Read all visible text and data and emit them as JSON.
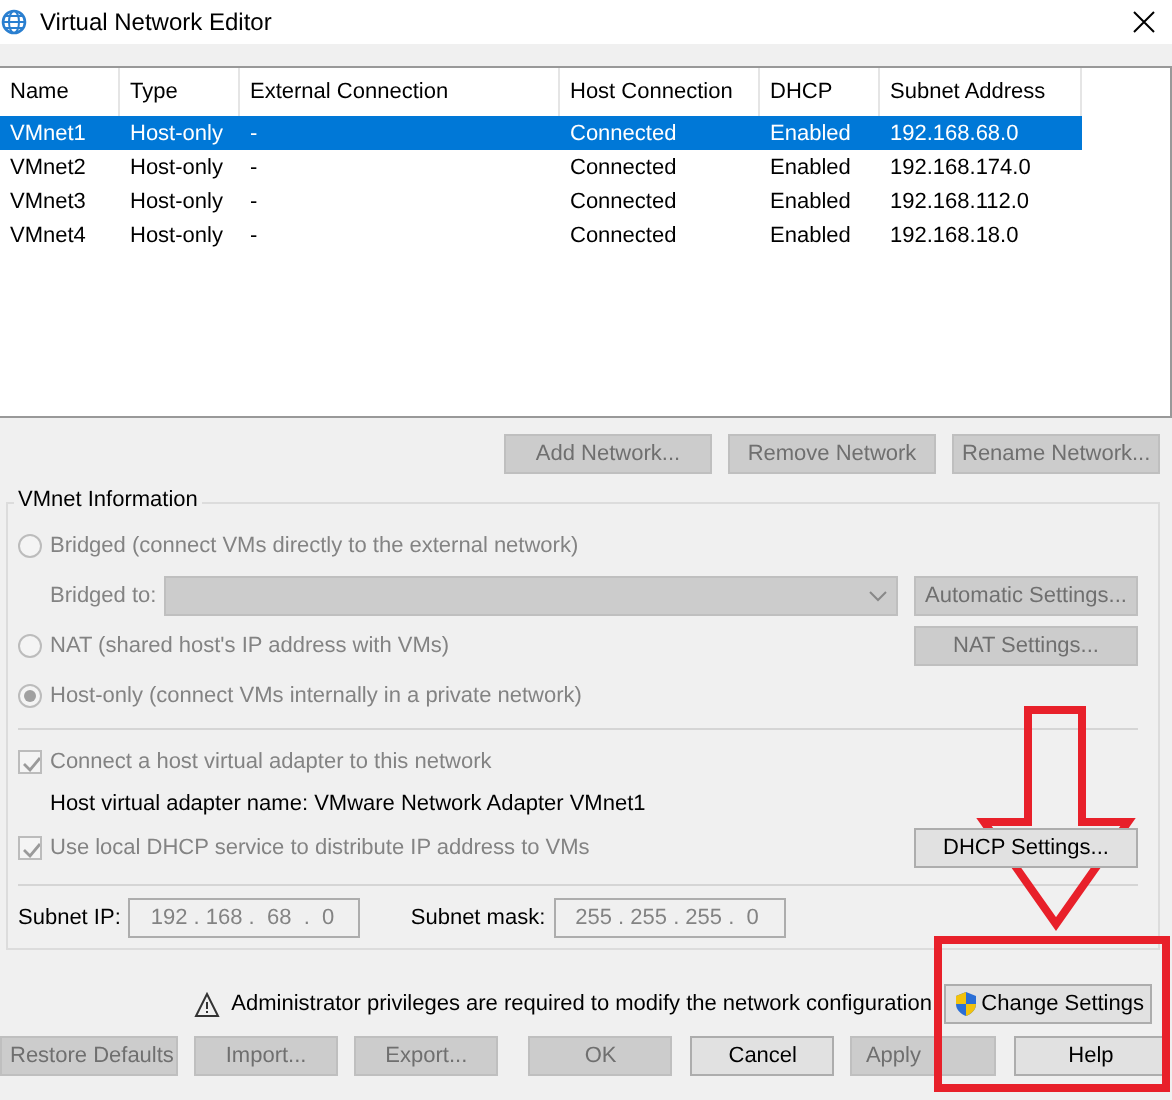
{
  "window": {
    "title": "Virtual Network Editor"
  },
  "table": {
    "columns": [
      "Name",
      "Type",
      "External Connection",
      "Host Connection",
      "DHCP",
      "Subnet Address"
    ],
    "rows": [
      {
        "cells": [
          "VMnet1",
          "Host-only",
          "-",
          "Connected",
          "Enabled",
          "192.168.68.0"
        ],
        "selected": true
      },
      {
        "cells": [
          "VMnet2",
          "Host-only",
          "-",
          "Connected",
          "Enabled",
          "192.168.174.0"
        ],
        "selected": false
      },
      {
        "cells": [
          "VMnet3",
          "Host-only",
          "-",
          "Connected",
          "Enabled",
          "192.168.112.0"
        ],
        "selected": false
      },
      {
        "cells": [
          "VMnet4",
          "Host-only",
          "-",
          "Connected",
          "Enabled",
          "192.168.18.0"
        ],
        "selected": false
      }
    ]
  },
  "network_buttons": [
    {
      "label": "Add Network...",
      "disabled": true
    },
    {
      "label": "Remove Network",
      "disabled": true
    },
    {
      "label": "Rename Network...",
      "disabled": true
    }
  ],
  "vmnet_info": {
    "title": "VMnet Information",
    "modes": [
      {
        "label": "Bridged (connect VMs directly to the external network)",
        "selected": false,
        "disabled": true
      },
      {
        "label": "NAT (shared host's IP address with VMs)",
        "selected": false,
        "disabled": true
      },
      {
        "label": "Host-only (connect VMs internally in a private network)",
        "selected": true,
        "disabled": true
      }
    ],
    "bridged_to": {
      "label": "Bridged to:",
      "disabled": true
    },
    "automatic_settings": {
      "label": "Automatic Settings...",
      "disabled": true
    },
    "nat_settings": {
      "label": "NAT Settings...",
      "disabled": true
    },
    "connect_adapter": {
      "label": "Connect a host virtual adapter to this network",
      "checked": true,
      "disabled": true
    },
    "adapter_name": "Host virtual adapter name: VMware Network Adapter VMnet1",
    "use_dhcp": {
      "label": "Use local DHCP service to distribute IP address to VMs",
      "checked": true,
      "disabled": true
    },
    "dhcp_settings": {
      "label": "DHCP Settings...",
      "disabled": false
    },
    "subnet_ip": {
      "label": "Subnet IP:",
      "value": "192 . 168 .  68  .  0",
      "disabled": true
    },
    "subnet_mask": {
      "label": "Subnet mask:",
      "value": "255 . 255 . 255 .  0",
      "disabled": true
    }
  },
  "notice": {
    "text": "Administrator privileges are required to modify the network configuration",
    "button": {
      "label": "Change Settings",
      "disabled": false
    }
  },
  "buttons": [
    {
      "label": "Restore Defaults",
      "disabled": true
    },
    {
      "label": "Import...",
      "disabled": true
    },
    {
      "label": "Export...",
      "disabled": true
    },
    {
      "label": "OK",
      "disabled": true
    },
    {
      "label": "Cancel",
      "disabled": false
    },
    {
      "label": "Apply",
      "disabled": true
    },
    {
      "label": "Help",
      "disabled": false
    }
  ]
}
